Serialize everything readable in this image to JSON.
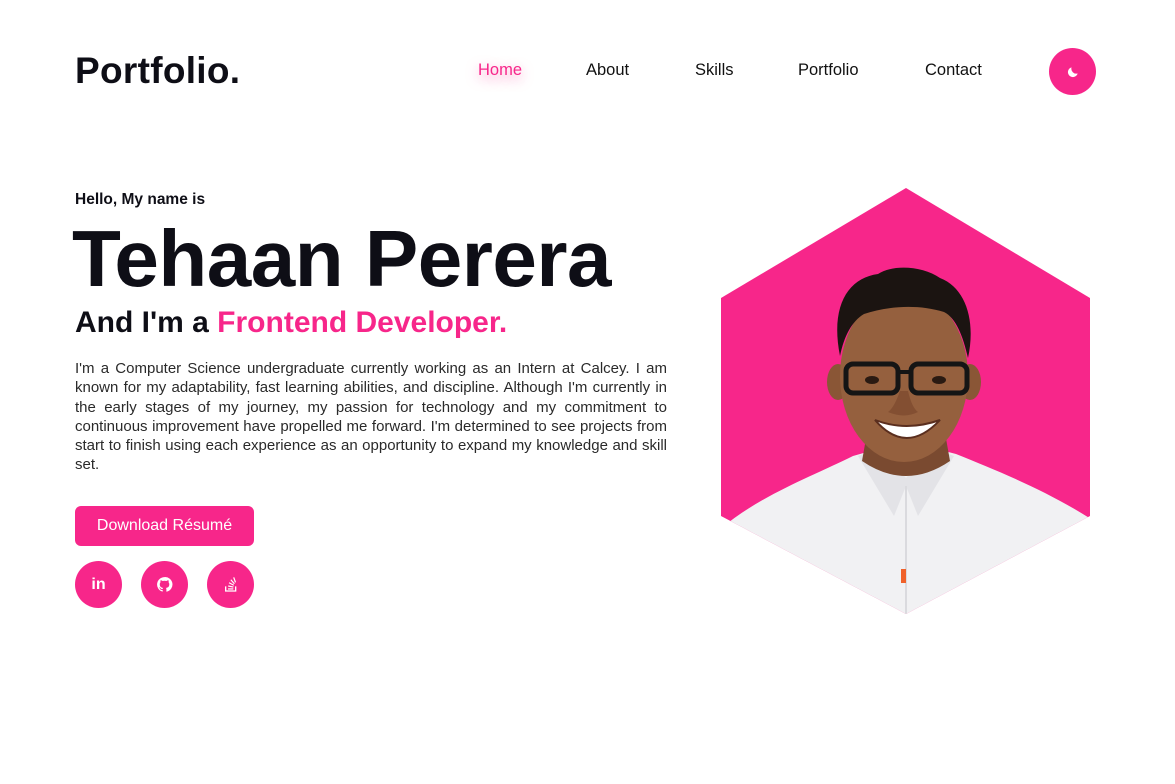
{
  "header": {
    "logo": "Portfolio.",
    "nav": [
      {
        "label": "Home",
        "active": true
      },
      {
        "label": "About",
        "active": false
      },
      {
        "label": "Skills",
        "active": false
      },
      {
        "label": "Portfolio",
        "active": false
      },
      {
        "label": "Contact",
        "active": false
      }
    ],
    "theme_toggle_icon": "moon-icon"
  },
  "hero": {
    "greeting": "Hello, My name is",
    "name": "Tehaan Perera",
    "role_prefix": "And I'm a",
    "role_highlight": "Frontend Developer.",
    "bio": "I'm a Computer Science undergraduate currently working as an Intern at Calcey. I am known for my adaptability, fast learning abilities, and discipline. Although I'm currently in the early stages of my journey, my passion for technology and my commitment to continuous improvement have propelled me forward. I'm determined to see projects from start to finish using each experience as an opportunity to expand my knowledge and skill set.",
    "cta_label": "Download Résumé",
    "social": [
      {
        "icon": "linkedin-icon",
        "label": "in"
      },
      {
        "icon": "github-icon"
      },
      {
        "icon": "stackoverflow-icon"
      }
    ]
  },
  "colors": {
    "accent": "#f7268a",
    "text": "#0e0e16",
    "background": "#ffffff"
  }
}
